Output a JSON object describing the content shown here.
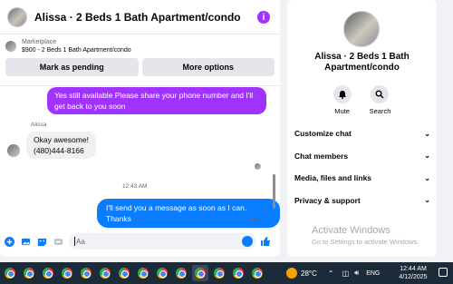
{
  "chat": {
    "title": "Alissa · 2 Beds 1 Bath Apartment/condo",
    "info_icon": "info-icon",
    "marketplace_label": "Marketplace",
    "listing": "$900 - 2 Beds 1 Bath Apartment/condo",
    "buttons": {
      "pending": "Mark as pending",
      "more": "More options"
    },
    "messages": {
      "outgoing_1": "Yes still available Please share your phone number and I'll get back to you soon",
      "sender_name": "Alissa",
      "incoming_1_line1": "Okay awesome!",
      "incoming_1_line2": "(480)444-8166",
      "timestamp": "12:43 AM",
      "outgoing_2": "I'll send you a message as soon as I can. Thanks",
      "status": "Sent"
    },
    "composer": {
      "placeholder": "Aa"
    },
    "colors": {
      "accent_purple": "#a033ff",
      "bubble_blue": "#0a7cff"
    }
  },
  "info_panel": {
    "name_line1": "Alissa · 2 Beds 1 Bath",
    "name_line2": "Apartment/condo",
    "actions": {
      "mute": "Mute",
      "search": "Search"
    },
    "menu": [
      "Customize chat",
      "Chat members",
      "Media, files and links",
      "Privacy & support"
    ]
  },
  "watermark": {
    "line1": "Activate Windows",
    "line2": "Go to Settings to activate Windows."
  },
  "taskbar": {
    "temperature": "28°C",
    "language": "ENG",
    "time": "12:44 AM",
    "date": "4/12/2025",
    "app_count": 14
  }
}
